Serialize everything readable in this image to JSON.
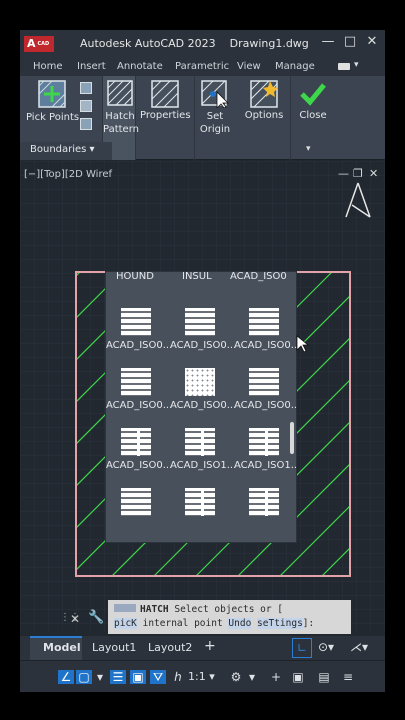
{
  "app": {
    "logo": "A",
    "logo_sub": "CAD",
    "title": "Autodesk AutoCAD 2023",
    "document": "Drawing1.dwg"
  },
  "window_controls": {
    "minimize": "—",
    "restore": "□",
    "close": "✕"
  },
  "ribbon_tabs": [
    "Home",
    "Insert",
    "Annotate",
    "Parametric",
    "View",
    "Manage"
  ],
  "ribbon": {
    "pick_points": "Pick Points",
    "hatch_pattern_line1": "Hatch",
    "hatch_pattern_line2": "Pattern",
    "properties": "Properties",
    "set_origin_line1": "Set",
    "set_origin_line2": "Origin",
    "options": "Options",
    "close": "Close",
    "boundaries": "Boundaries ▾"
  },
  "viewport": {
    "label": "[−][Top][2D Wiref",
    "hatch_color": "#3ed64a",
    "border_color": "#e2a3a8"
  },
  "pattern_header": [
    "HOUND",
    "INSUL",
    "ACAD_ISO0"
  ],
  "patterns": [
    {
      "name": "ACAD_ISO0...",
      "style": "lines"
    },
    {
      "name": "ACAD_ISO0...",
      "style": "lines"
    },
    {
      "name": "ACAD_ISO0...",
      "style": "lines"
    },
    {
      "name": "ACAD_ISO0...",
      "style": "lines"
    },
    {
      "name": "ACAD_ISO0...",
      "style": "dots"
    },
    {
      "name": "ACAD_ISO0...",
      "style": "lines"
    },
    {
      "name": "ACAD_ISO0...",
      "style": "dashes"
    },
    {
      "name": "ACAD_ISO1...",
      "style": "dashes"
    },
    {
      "name": "ACAD_ISO1...",
      "style": "dashes"
    },
    {
      "name": "",
      "style": "lines"
    },
    {
      "name": "",
      "style": "dashes"
    },
    {
      "name": "",
      "style": "dashes"
    }
  ],
  "command": {
    "cmd": "HATCH",
    "prompt1": "Select objects or [",
    "opt1": "picK",
    "mid": " internal point ",
    "opt2": "Undo",
    "sp": " ",
    "opt3": "seTtings",
    "end": "]:"
  },
  "layout_tabs": [
    "Model",
    "Layout1",
    "Layout2"
  ],
  "layout_add": "+",
  "status": {
    "scale": "1:1 ▾",
    "icons": [
      "∠",
      "▢",
      "☰",
      "▣",
      "⛛",
      "ℎ",
      "⚙",
      "+",
      "▣",
      "▤",
      "≡"
    ]
  }
}
